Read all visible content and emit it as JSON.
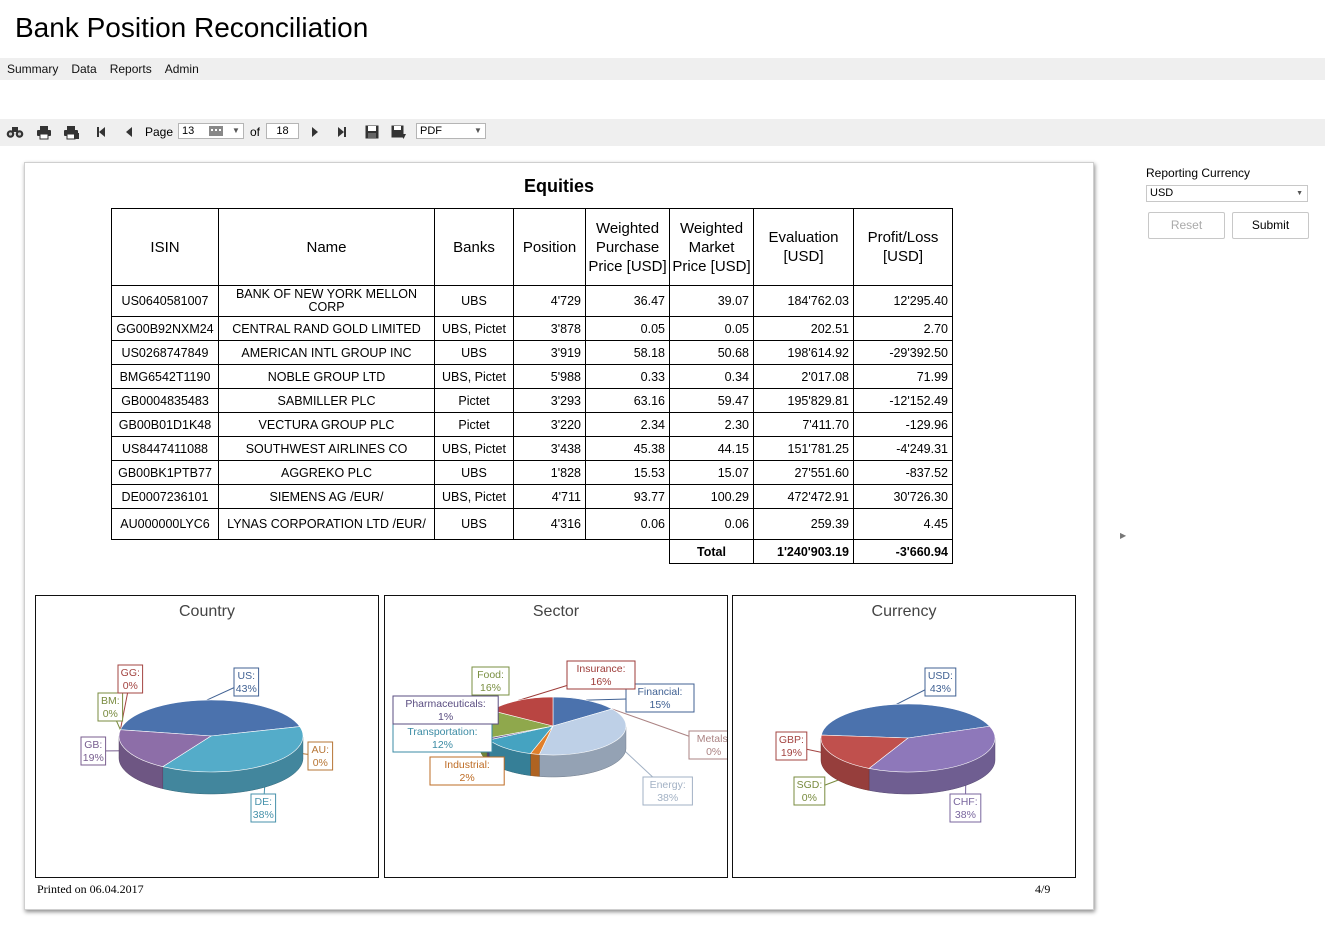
{
  "app": {
    "title": "Bank Position Reconciliation"
  },
  "menu": [
    "Summary",
    "Data",
    "Reports",
    "Admin"
  ],
  "toolbar": {
    "page_label": "Page",
    "page_current": "13",
    "of_label": "of",
    "page_total": "18",
    "export_format": "PDF"
  },
  "right_panel": {
    "reporting_currency_label": "Reporting Currency",
    "currency_value": "USD",
    "reset_label": "Reset",
    "submit_label": "Submit"
  },
  "report": {
    "title": "Equities",
    "columns": [
      "ISIN",
      "Name",
      "Banks",
      "Position",
      "Weighted Purchase Price [USD]",
      "Weighted Market Price [USD]",
      "Evaluation [USD]",
      "Profit/Loss [USD]"
    ],
    "rows": [
      [
        "US0640581007",
        "BANK OF NEW YORK MELLON CORP",
        "UBS",
        "4'729",
        "36.47",
        "39.07",
        "184'762.03",
        "12'295.40"
      ],
      [
        "GG00B92NXM24",
        "CENTRAL RAND GOLD LIMITED",
        "UBS, Pictet",
        "3'878",
        "0.05",
        "0.05",
        "202.51",
        "2.70"
      ],
      [
        "US0268747849",
        "AMERICAN INTL GROUP INC",
        "UBS",
        "3'919",
        "58.18",
        "50.68",
        "198'614.92",
        "-29'392.50"
      ],
      [
        "BMG6542T1190",
        "NOBLE GROUP LTD",
        "UBS, Pictet",
        "5'988",
        "0.33",
        "0.34",
        "2'017.08",
        "71.99"
      ],
      [
        "GB0004835483",
        "SABMILLER PLC",
        "Pictet",
        "3'293",
        "63.16",
        "59.47",
        "195'829.81",
        "-12'152.49"
      ],
      [
        "GB00B01D1K48",
        "VECTURA GROUP PLC",
        "Pictet",
        "3'220",
        "2.34",
        "2.30",
        "7'411.70",
        "-129.96"
      ],
      [
        "US8447411088",
        "SOUTHWEST AIRLINES CO",
        "UBS, Pictet",
        "3'438",
        "45.38",
        "44.15",
        "151'781.25",
        "-4'249.31"
      ],
      [
        "GB00BK1PTB77",
        "AGGREKO PLC",
        "UBS",
        "1'828",
        "15.53",
        "15.07",
        "27'551.60",
        "-837.52"
      ],
      [
        "DE0007236101",
        "SIEMENS AG /EUR/",
        "UBS, Pictet",
        "4'711",
        "93.77",
        "100.29",
        "472'472.91",
        "30'726.30"
      ],
      [
        "AU000000LYC6",
        "LYNAS CORPORATION LTD /EUR/",
        "UBS",
        "4'316",
        "0.06",
        "0.06",
        "259.39",
        "4.45"
      ]
    ],
    "total_label": "Total",
    "total_evaluation": "1'240'903.19",
    "total_profit_loss": "-3'660.94",
    "printed_on": "Printed on 06.04.2017",
    "page_indicator": "4/9"
  },
  "chart_data": [
    {
      "type": "pie",
      "title": "Country",
      "slices": [
        {
          "name": "US",
          "value": 43,
          "color": "#4b72ad"
        },
        {
          "name": "DE",
          "value": 38,
          "color": "#54acc9"
        },
        {
          "name": "GB",
          "value": 19,
          "color": "#8d6ea8"
        },
        {
          "name": "BM",
          "value": 0,
          "color": "#8ea34a"
        },
        {
          "name": "GG",
          "value": 0,
          "color": "#c0504d"
        },
        {
          "name": "AU",
          "value": 0,
          "color": "#d68a3e"
        }
      ]
    },
    {
      "type": "pie",
      "title": "Sector",
      "slices": [
        {
          "name": "Financial",
          "value": 15,
          "color": "#4b72ad"
        },
        {
          "name": "Metals",
          "value": 0,
          "color": "#c99a9a"
        },
        {
          "name": "Energy",
          "value": 38,
          "color": "#bed0e7"
        },
        {
          "name": "Industrial",
          "value": 2,
          "color": "#e07f2b"
        },
        {
          "name": "Transportation",
          "value": 12,
          "color": "#45a3c1"
        },
        {
          "name": "Pharmaceuticals",
          "value": 1,
          "color": "#6a5a98"
        },
        {
          "name": "Food",
          "value": 16,
          "color": "#8fa84c"
        },
        {
          "name": "Insurance",
          "value": 16,
          "color": "#b94542"
        }
      ]
    },
    {
      "type": "pie",
      "title": "Currency",
      "slices": [
        {
          "name": "USD",
          "value": 43,
          "color": "#4b72ad"
        },
        {
          "name": "CHF",
          "value": 38,
          "color": "#8e78ba"
        },
        {
          "name": "SGD",
          "value": 0,
          "color": "#8ea34a"
        },
        {
          "name": "GBP",
          "value": 19,
          "color": "#c0504d"
        }
      ]
    }
  ]
}
